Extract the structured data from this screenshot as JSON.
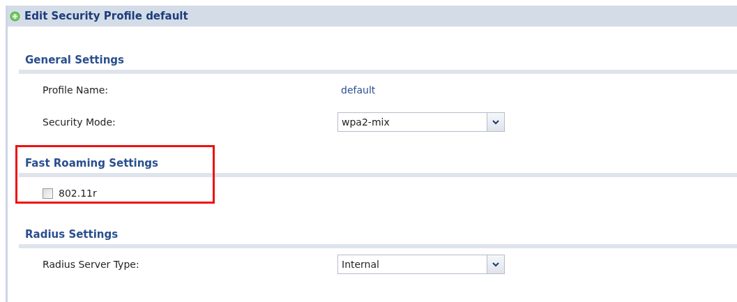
{
  "window": {
    "title": "Edit Security Profile default"
  },
  "sections": [
    {
      "title": "General Settings",
      "highlighted": false,
      "rows": [
        {
          "kind": "text",
          "label": "Profile Name:",
          "value": "default"
        },
        {
          "kind": "select",
          "label": "Security Mode:",
          "value": "wpa2-mix"
        }
      ]
    },
    {
      "title": "Fast Roaming Settings",
      "highlighted": true,
      "rows": [
        {
          "kind": "checkbox",
          "label": "802.11r",
          "checked": false
        }
      ]
    },
    {
      "title": "Radius Settings",
      "highlighted": false,
      "rows": [
        {
          "kind": "select",
          "label": "Radius Server Type:",
          "value": "Internal"
        }
      ]
    }
  ]
}
